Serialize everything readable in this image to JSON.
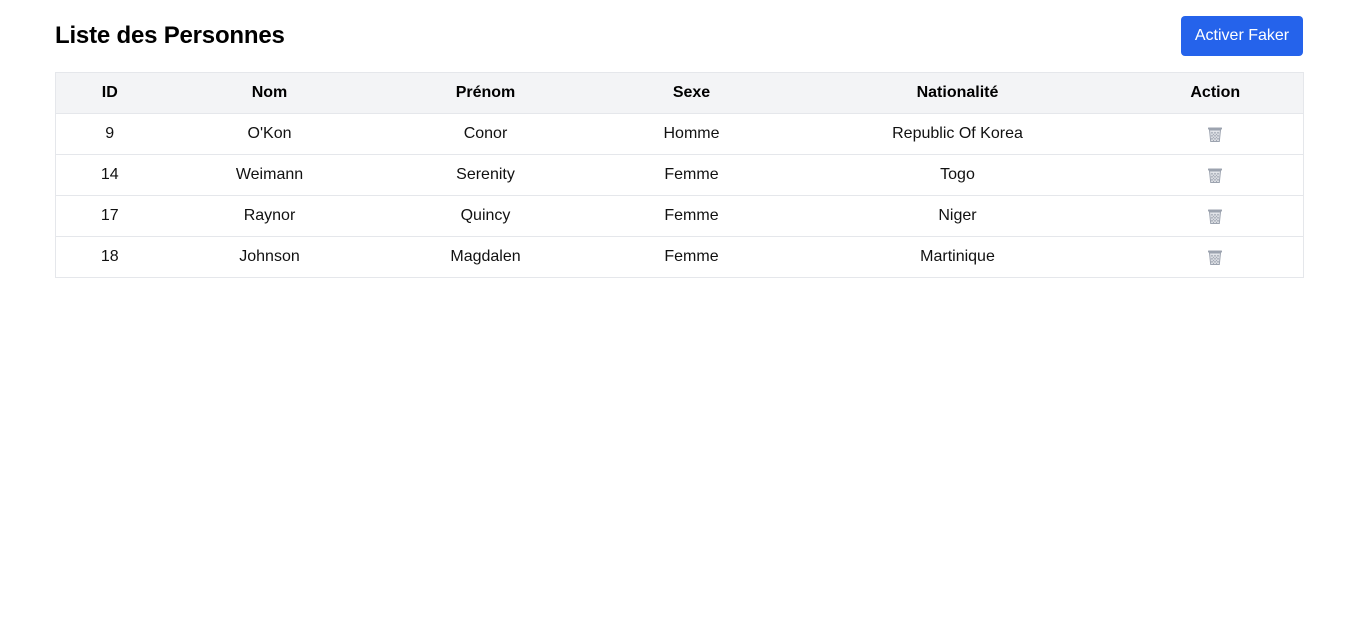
{
  "page": {
    "title": "Liste des Personnes",
    "faker_button_label": "Activer Faker"
  },
  "table": {
    "headers": [
      "ID",
      "Nom",
      "Prénom",
      "Sexe",
      "Nationalité",
      "Action"
    ],
    "rows": [
      {
        "id": "9",
        "nom": "O'Kon",
        "prenom": "Conor",
        "sexe": "Homme",
        "nationalite": "Republic Of Korea",
        "action_icon": "trash-icon"
      },
      {
        "id": "14",
        "nom": "Weimann",
        "prenom": "Serenity",
        "sexe": "Femme",
        "nationalite": "Togo",
        "action_icon": "trash-icon"
      },
      {
        "id": "17",
        "nom": "Raynor",
        "prenom": "Quincy",
        "sexe": "Femme",
        "nationalite": "Niger",
        "action_icon": "trash-icon"
      },
      {
        "id": "18",
        "nom": "Johnson",
        "prenom": "Magdalen",
        "sexe": "Femme",
        "nationalite": "Martinique",
        "action_icon": "trash-icon"
      }
    ]
  },
  "colors": {
    "accent": "#2563eb",
    "header_bg": "#f3f4f6",
    "border": "#e5e7eb",
    "trash_icon": "#9ca3af"
  }
}
